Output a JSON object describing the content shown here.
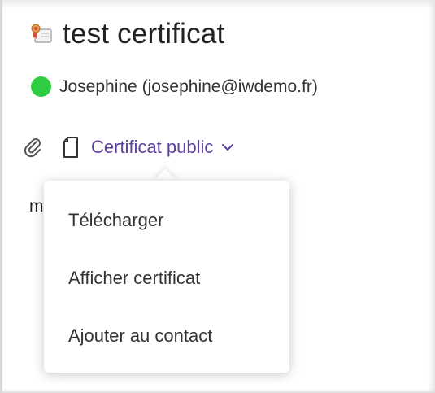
{
  "header": {
    "title": "test certificat",
    "icon": "certificate-icon"
  },
  "owner": {
    "label": "Josephine (josephine@iwdemo.fr)",
    "status_color": "#2ecc40"
  },
  "attachment": {
    "clip_icon": "paperclip-icon",
    "doc_icon": "document-icon",
    "label": "Certificat public",
    "link_color": "#5c3f9e"
  },
  "behind_text": "m",
  "menu": {
    "items": [
      {
        "label": "Télécharger"
      },
      {
        "label": "Afficher certificat"
      },
      {
        "label": "Ajouter au contact"
      }
    ]
  }
}
